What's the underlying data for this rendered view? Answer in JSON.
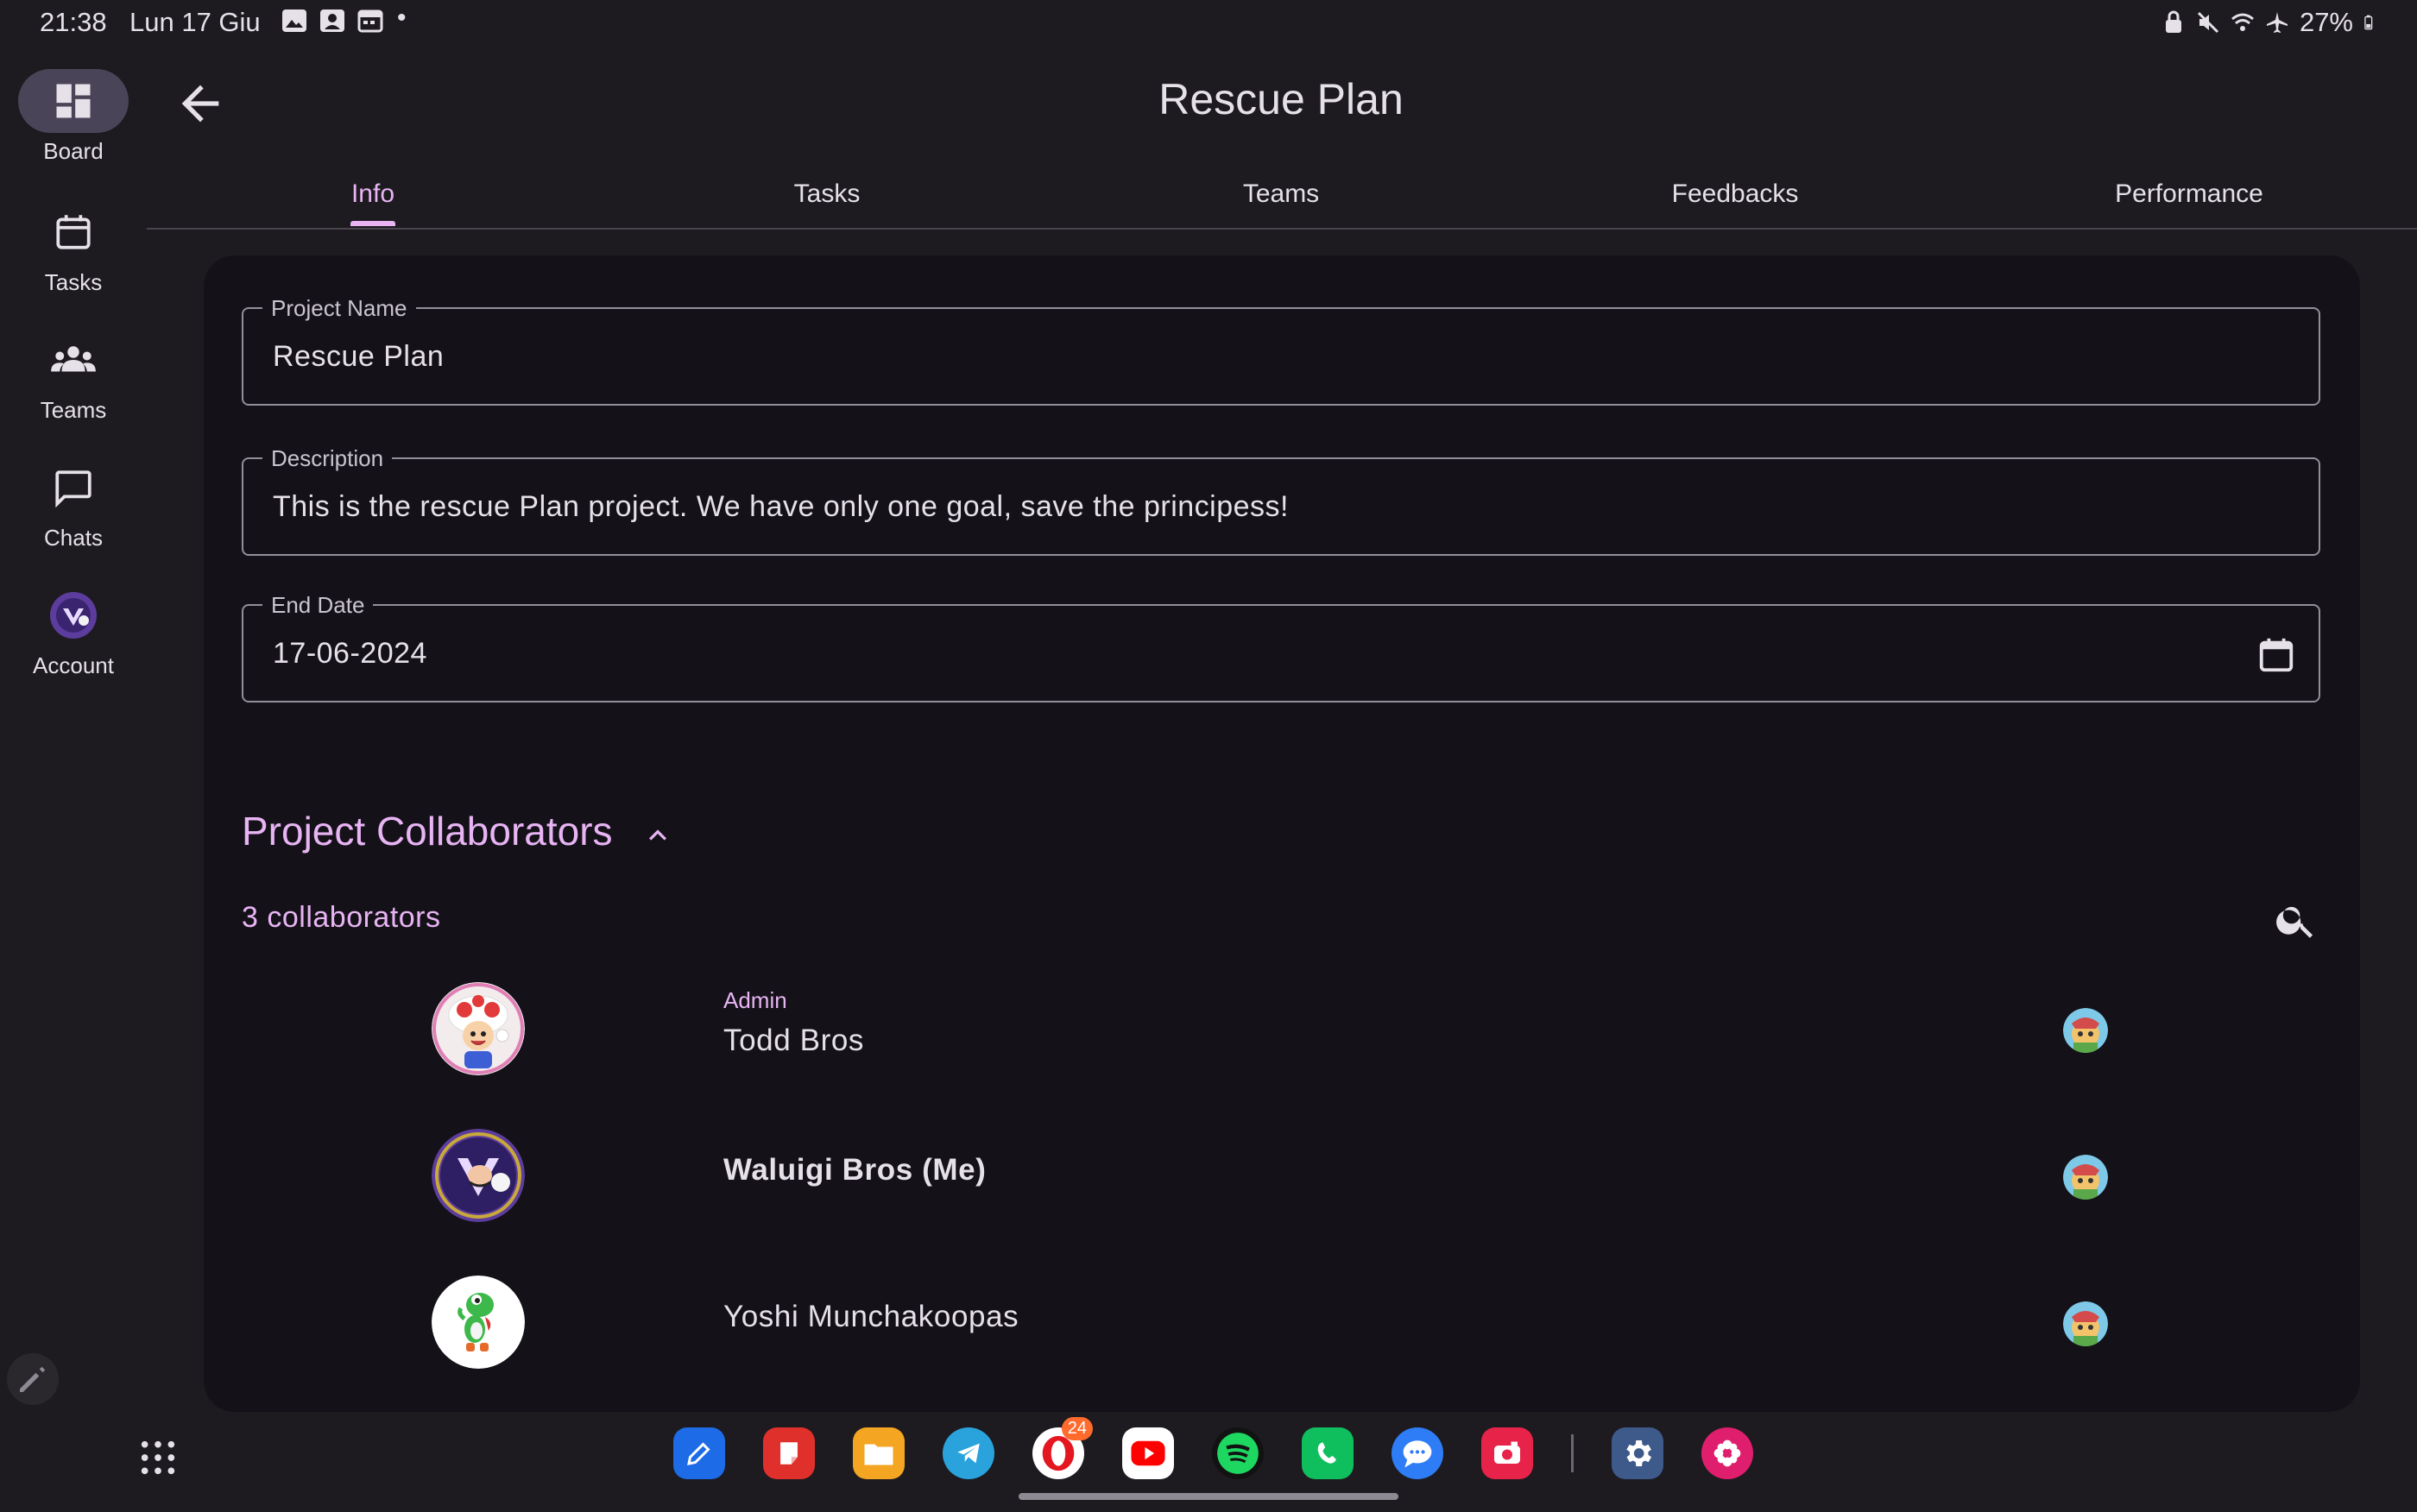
{
  "status_bar": {
    "time": "21:38",
    "date": "Lun 17 Giu",
    "dot": "•",
    "battery": "27%"
  },
  "rail": {
    "items": [
      {
        "label": "Board",
        "icon": "dashboard-icon",
        "active": true
      },
      {
        "label": "Tasks",
        "icon": "calendar-icon"
      },
      {
        "label": "Teams",
        "icon": "groups-icon"
      },
      {
        "label": "Chats",
        "icon": "chat-bubble-icon"
      },
      {
        "label": "Account",
        "icon": "avatar-icon"
      }
    ]
  },
  "header": {
    "title": "Rescue Plan"
  },
  "tabs": [
    {
      "label": "Info",
      "active": true
    },
    {
      "label": "Tasks"
    },
    {
      "label": "Teams"
    },
    {
      "label": "Feedbacks"
    },
    {
      "label": "Performance"
    }
  ],
  "form": {
    "project_name": {
      "label": "Project Name",
      "value": "Rescue Plan"
    },
    "description": {
      "label": "Description",
      "value": "This is the rescue Plan project. We have only one goal, save the principess!"
    },
    "end_date": {
      "label": "End Date",
      "value": "17-06-2024"
    }
  },
  "collaborators": {
    "title": "Project Collaborators",
    "count_text": "3 collaborators",
    "list": [
      {
        "role": "Admin",
        "name": "Todd Bros"
      },
      {
        "role": "",
        "name": "Waluigi Bros (Me)"
      },
      {
        "role": "",
        "name": "Yoshi Munchakoopas"
      }
    ]
  },
  "dock": {
    "badge": "24"
  },
  "colors": {
    "accent": "#e8b4f4",
    "background": "#1d1b20",
    "card": "#141218"
  }
}
